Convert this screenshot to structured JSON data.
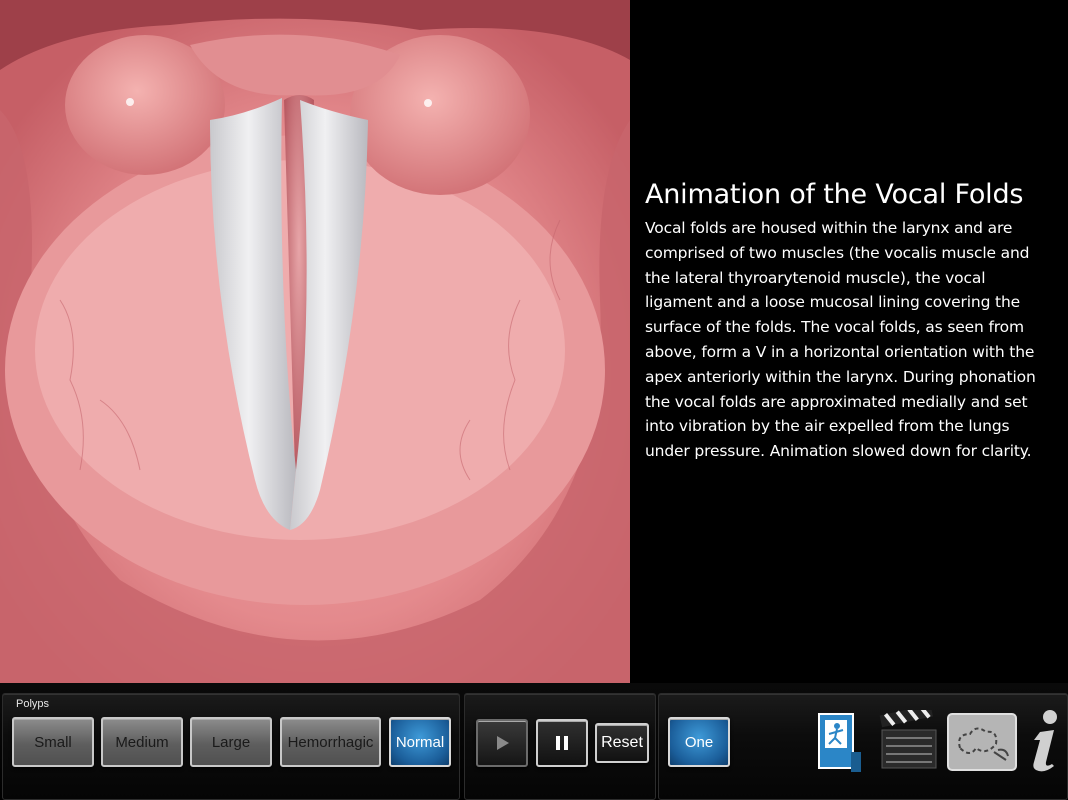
{
  "content": {
    "title": "Animation of the Vocal Folds",
    "body": "Vocal folds are housed within the larynx and are comprised of two muscles (the vocalis muscle and the lateral thyroarytenoid muscle), the vocal ligament and a loose mucosal lining covering the surface of the folds. The vocal folds, as seen from above, form a V in a horizontal orientation with the apex anteriorly within the larynx. During phonation the vocal folds are approximated medially and set into vibration by the air expelled from the lungs under pressure. Animation slowed down for clarity."
  },
  "toolbar": {
    "group_label": "Polyps",
    "size_options": [
      {
        "label": "Small",
        "selected": false
      },
      {
        "label": "Medium",
        "selected": false
      },
      {
        "label": "Large",
        "selected": false
      },
      {
        "label": "Hemorrhagic",
        "selected": false
      },
      {
        "label": "Normal",
        "selected": true
      }
    ],
    "playback": {
      "play_icon": "play-icon",
      "pause_icon": "pause-icon",
      "reset_label": "Reset"
    },
    "view_mode_label": "One",
    "nav_icons": [
      "running-figure-icon",
      "clapperboard-icon",
      "sketch-icon",
      "info-icon"
    ]
  },
  "colors": {
    "selected_blue": "#1b5e9a",
    "tissue_pink": "#d46a70",
    "background": "#000000"
  }
}
